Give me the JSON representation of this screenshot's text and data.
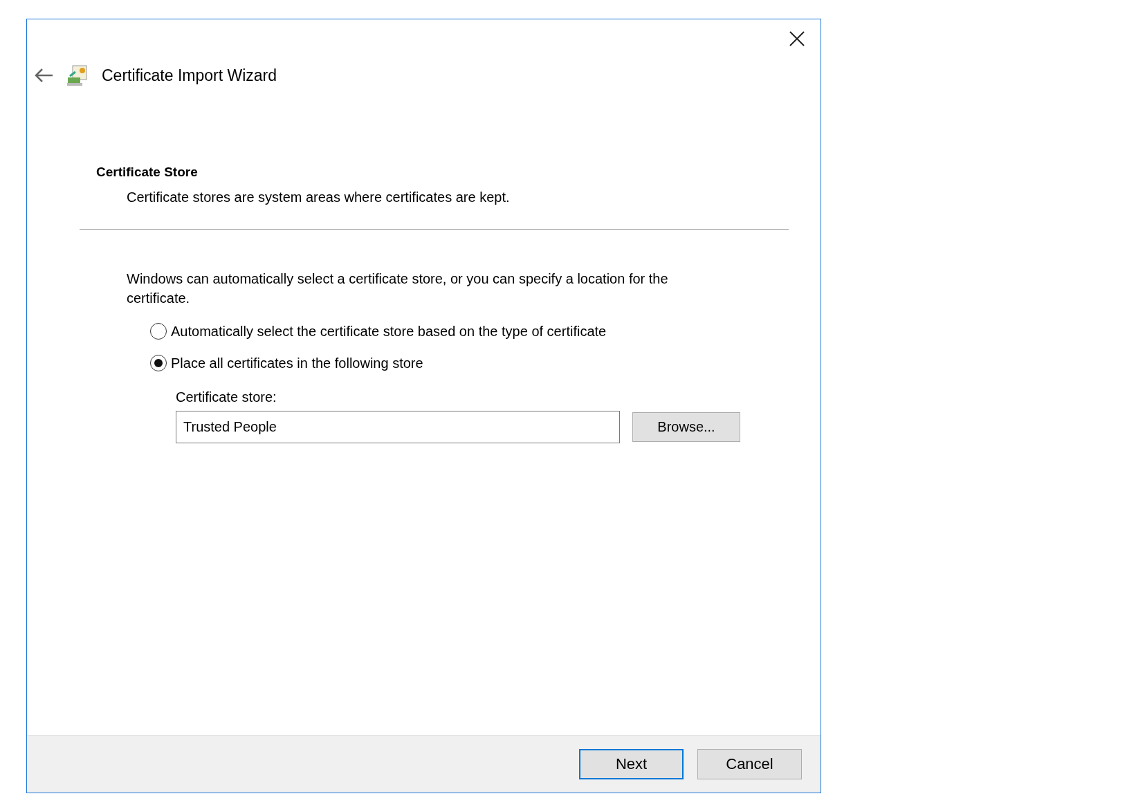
{
  "window": {
    "title": "Certificate Import Wizard"
  },
  "page": {
    "heading": "Certificate Store",
    "subtitle": "Certificate stores are system areas where certificates are kept."
  },
  "description": "Windows can automatically select a certificate store, or you can specify a location for the certificate.",
  "options": [
    {
      "label": "Automatically select the certificate store based on the type of certificate",
      "selected": false
    },
    {
      "label": "Place all certificates in the following store",
      "selected": true
    }
  ],
  "store": {
    "label": "Certificate store:",
    "value": "Trusted People",
    "browse": "Browse..."
  },
  "buttons": [
    {
      "label": "Next",
      "default": true
    },
    {
      "label": "Cancel",
      "default": false
    }
  ]
}
